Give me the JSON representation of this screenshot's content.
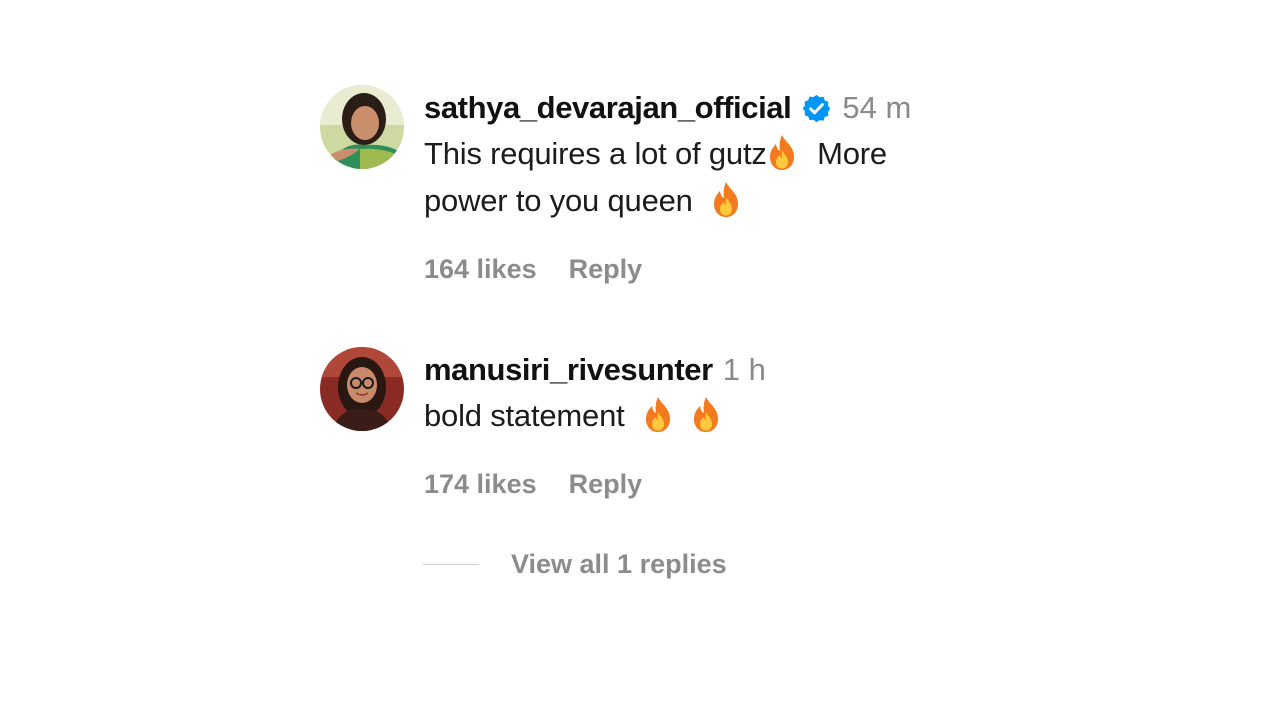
{
  "comments": [
    {
      "username": "sathya_devarajan_official",
      "verified": true,
      "time": "54 m",
      "text_line1": "This requires a lot of gutz",
      "text_line1_after": "More",
      "text_line2": "power to you queen",
      "likes": "164 likes",
      "reply_label": "Reply",
      "avatar": "profile-photo"
    },
    {
      "username": "manusiri_rivesunter",
      "verified": false,
      "time": "1 h",
      "text": "bold statement",
      "likes": "174 likes",
      "reply_label": "Reply",
      "avatar": "profile-photo"
    }
  ],
  "view_replies_label": "View all 1 replies",
  "icons": {
    "verified": "verified-badge-icon",
    "fire": "fire-emoji-icon"
  },
  "colors": {
    "verified_blue": "#0095f6",
    "secondary_text": "#8c8c8c",
    "fire_outer": "#f47a1f",
    "fire_inner": "#ffc93c"
  }
}
